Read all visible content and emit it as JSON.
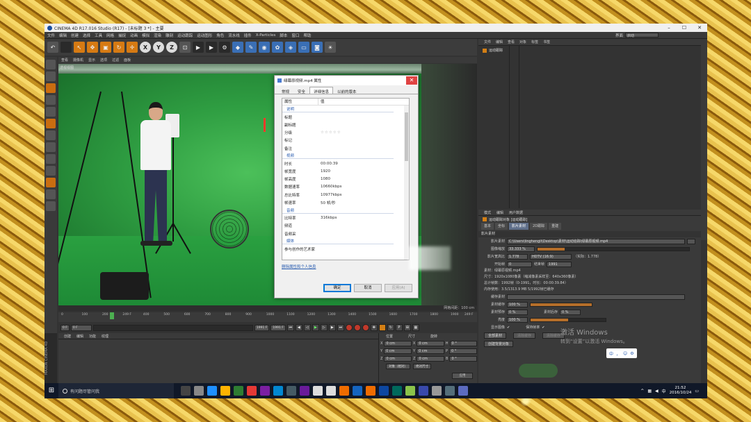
{
  "window": {
    "title": "CINEMA 4D R17.016 Studio (R17) - [未标题 3 *] - 主要",
    "layout_label": "界面",
    "layout_value": "启动"
  },
  "menu": [
    "文件",
    "编辑",
    "创建",
    "选择",
    "工具",
    "网格",
    "捕捉",
    "动画",
    "模拟",
    "渲染",
    "雕刻",
    "运动跟踪",
    "运动图形",
    "角色",
    "流水线",
    "插件",
    "X-Particles",
    "脚本",
    "窗口",
    "帮助"
  ],
  "viewport": {
    "menu": [
      "查看",
      "摄像机",
      "显示",
      "选项",
      "过滤",
      "面板"
    ],
    "label": "透视视图",
    "footer": "网格间距：100 cm"
  },
  "dialog": {
    "title": "绿幕原视频.mp4 属性",
    "tabs": [
      "常规",
      "安全",
      "详细信息",
      "以前的版本"
    ],
    "active_tab": "详细信息",
    "col_name": "属性",
    "col_value": "值",
    "rows": [
      {
        "k": "说明",
        "section": true
      },
      {
        "k": "标题",
        "v": ""
      },
      {
        "k": "副标题",
        "v": ""
      },
      {
        "k": "分级",
        "v": "☆☆☆☆☆"
      },
      {
        "k": "标记",
        "v": ""
      },
      {
        "k": "备注",
        "v": ""
      },
      {
        "k": "视频",
        "section": true
      },
      {
        "k": "时长",
        "v": "00:00:39"
      },
      {
        "k": "帧宽度",
        "v": "1920"
      },
      {
        "k": "帧高度",
        "v": "1080"
      },
      {
        "k": "数据速率",
        "v": "10660kbps"
      },
      {
        "k": "总比特率",
        "v": "10977kbps"
      },
      {
        "k": "帧速率",
        "v": "50 帧/秒"
      },
      {
        "k": "音频",
        "section": true
      },
      {
        "k": "比特率",
        "v": "316kbps"
      },
      {
        "k": "频道",
        "v": ""
      },
      {
        "k": "音频采",
        "v": ""
      },
      {
        "k": "媒体",
        "section": true
      },
      {
        "k": "参与创作的艺术家",
        "v": ""
      }
    ],
    "link": "删除属性和个人信息",
    "buttons": {
      "ok": "确定",
      "cancel": "取消",
      "apply": "应用(A)"
    }
  },
  "timeline": {
    "ticks": [
      "0",
      "100",
      "200",
      "249 F",
      "400",
      "500",
      "600",
      "700",
      "800",
      "900",
      "1000",
      "1100",
      "1200",
      "1300",
      "1400",
      "1500",
      "1600",
      "1700",
      "1800",
      "1900"
    ],
    "end_label": "249 F",
    "current_frame": "0 F",
    "start_field": "0 F",
    "end_field": "1991 F",
    "end_field2": "1991 F"
  },
  "bottom_menu": [
    "创建",
    "编辑",
    "功能",
    "纹理"
  ],
  "coords": {
    "headers": [
      "位置",
      "尺寸",
      "旋转"
    ],
    "rows": [
      {
        "axis": "X",
        "pos": "0 cm",
        "size": "0 cm",
        "rot_axis": "H",
        "rot": "0 °"
      },
      {
        "axis": "Y",
        "pos": "0 cm",
        "size": "0 cm",
        "rot_axis": "P",
        "rot": "0 °"
      },
      {
        "axis": "Z",
        "pos": "0 cm",
        "size": "0 cm",
        "rot_axis": "B",
        "rot": "0 °"
      }
    ],
    "mode1": "对象（相对）",
    "mode2": "绝对尺寸",
    "apply": "应用"
  },
  "side_logo": "MAXON CINEMA 4D",
  "object_manager": {
    "menu": [
      "文件",
      "编辑",
      "查看",
      "对象",
      "标签",
      "书签"
    ],
    "item": "运动跟踪"
  },
  "attribute_manager": {
    "menu": [
      "模式",
      "编辑",
      "用户数据"
    ],
    "title": "运动跟踪对象 [运动跟踪]",
    "tabs": [
      "基本",
      "坐标",
      "影片素材",
      "2D跟踪",
      "重建"
    ],
    "active_tab": "影片素材",
    "section": "影片素材",
    "footage_label": "影片素材",
    "footage_path": "C:\\Users\\linghengli\\Desktop\\素材\\运动追踪\\绿幕原视频.mp4",
    "scale_label": "图像缩放",
    "scale_value": "33.333 %",
    "aspect_label": "影片宽高比",
    "aspect_value": "1.778",
    "aspect_preset": "HDTV (16:9)",
    "aspect_readout": "（实际：1.778）",
    "start_label": "开始帧",
    "start_value": "0",
    "end_label": "结束帧",
    "end_value": "1991",
    "info_footage": "素材：绿幕原视频.mp4",
    "info_size": "尺寸：1920x1080像素（缩减像素采样至：640x360像素）",
    "info_frames": "总计帧数：1992帧（0-1991，时长：00:00:39.84）",
    "info_memory": "内存使用：3.5/1313.9 MB 5/1992帧已缓存",
    "cache_label": "缓存素材",
    "cache_pct_label": "素材缓存",
    "cache_pct": "100 %",
    "cache_pct_fraction": 1.0,
    "cache_a_label": "素材预存",
    "cache_a": "0 %",
    "cache_b_label": "素材后存",
    "cache_b": "0 %",
    "bright_label": "亮度",
    "bright_value": "100 %",
    "bright_fraction": 0.5,
    "show_image_label": "显示图像",
    "keep_label": "保持帧率",
    "btn_full": "全部素材",
    "btn_a": "清除缓存",
    "btn_b": "清除缓存",
    "btn_create": "创建背景对象"
  },
  "activation": {
    "line1": "激活 Windows",
    "line2": "转到“设置”以激活 Windows。"
  },
  "ime": [
    "中",
    "，",
    "☺",
    "⚙"
  ],
  "taskbar": {
    "search": "有问题尽管问我",
    "time": "21:52",
    "date": "2016/10/24",
    "lang": "中"
  },
  "colors": {
    "accent_orange": "#d67a13",
    "green_screen": "#2f9e42",
    "frame_gold": "#c99a30"
  }
}
